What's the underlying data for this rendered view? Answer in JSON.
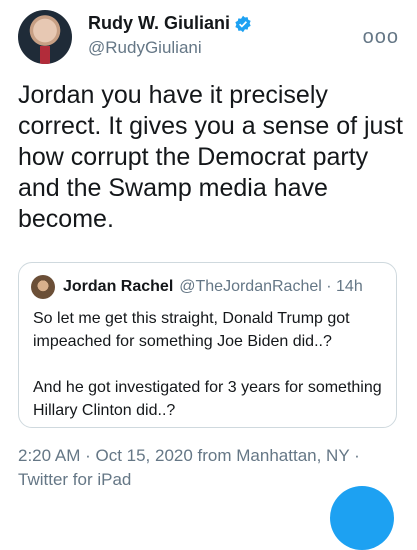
{
  "author": {
    "name": "Rudy W. Giuliani",
    "handle": "@RudyGiuliani",
    "verified": true,
    "avatar_icon": "profile-photo"
  },
  "more_icon_glyph": "ooo",
  "tweet": {
    "text": "Jordan you have it precisely correct. It gives you a sense of just how corrupt the Democrat party and the Swamp media have become."
  },
  "quoted_tweet": {
    "name": "Jordan Rachel",
    "handle_time": "@TheJordanRachel · 14h",
    "paragraph1": "So let me get this straight, Donald Trump got impeached for something Joe Biden did..?",
    "paragraph2": "And he got investigated for 3 years for something Hillary Clinton did..?"
  },
  "meta": {
    "line": "2:20 AM · Oct 15, 2020 from Manhattan, NY · Twitter for iPad"
  },
  "colors": {
    "accent": "#1da1f2",
    "text": "#14171a",
    "secondary": "#657786",
    "border": "#cfd9de"
  }
}
